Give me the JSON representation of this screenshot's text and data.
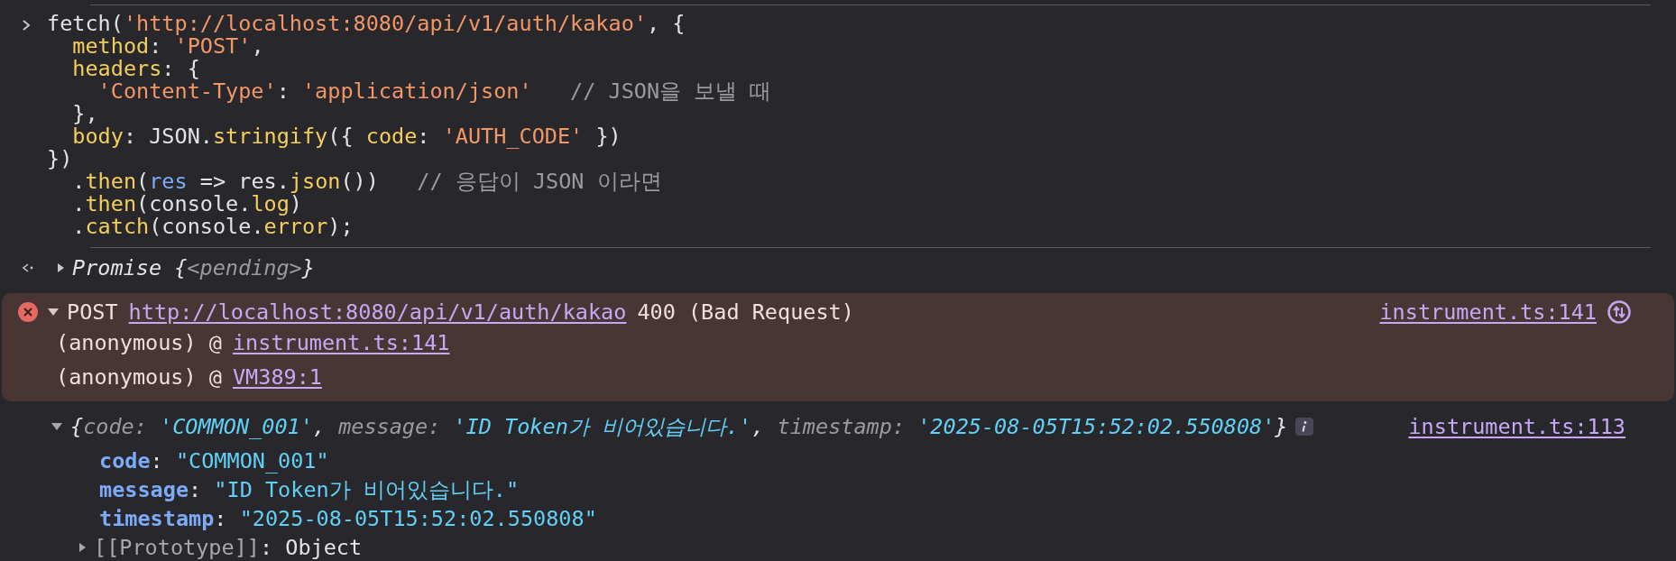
{
  "input": {
    "lines": [
      [
        {
          "kind": "plain",
          "text": "fetch("
        },
        {
          "kind": "string",
          "text": "'http://localhost:8080/api/v1/auth/kakao'"
        },
        {
          "kind": "plain",
          "text": ", {"
        }
      ],
      [
        {
          "kind": "key",
          "text": "  method"
        },
        {
          "kind": "plain",
          "text": ": "
        },
        {
          "kind": "string",
          "text": "'POST'"
        },
        {
          "kind": "plain",
          "text": ","
        }
      ],
      [
        {
          "kind": "key",
          "text": "  headers"
        },
        {
          "kind": "plain",
          "text": ": {"
        }
      ],
      [
        {
          "kind": "string",
          "text": "    'Content-Type'"
        },
        {
          "kind": "plain",
          "text": ": "
        },
        {
          "kind": "string",
          "text": "'application/json'"
        },
        {
          "kind": "comment",
          "text": "   // JSON을 보낼 때"
        }
      ],
      [
        {
          "kind": "plain",
          "text": "  },"
        }
      ],
      [
        {
          "kind": "key",
          "text": "  body"
        },
        {
          "kind": "plain",
          "text": ": JSON."
        },
        {
          "kind": "call",
          "text": "stringify"
        },
        {
          "kind": "plain",
          "text": "({ "
        },
        {
          "kind": "key",
          "text": "code"
        },
        {
          "kind": "plain",
          "text": ": "
        },
        {
          "kind": "string",
          "text": "'AUTH_CODE'"
        },
        {
          "kind": "plain",
          "text": " })"
        }
      ],
      [
        {
          "kind": "plain",
          "text": "})"
        }
      ],
      [
        {
          "kind": "plain",
          "text": "  ."
        },
        {
          "kind": "call",
          "text": "then"
        },
        {
          "kind": "plain",
          "text": "("
        },
        {
          "kind": "param",
          "text": "res"
        },
        {
          "kind": "plain",
          "text": " => res."
        },
        {
          "kind": "call",
          "text": "json"
        },
        {
          "kind": "plain",
          "text": "())   "
        },
        {
          "kind": "comment",
          "text": "// 응답이 JSON 이라면"
        }
      ],
      [
        {
          "kind": "plain",
          "text": "  ."
        },
        {
          "kind": "call",
          "text": "then"
        },
        {
          "kind": "plain",
          "text": "(console."
        },
        {
          "kind": "call",
          "text": "log"
        },
        {
          "kind": "plain",
          "text": ")"
        }
      ],
      [
        {
          "kind": "plain",
          "text": "  ."
        },
        {
          "kind": "call",
          "text": "catch"
        },
        {
          "kind": "plain",
          "text": "(console."
        },
        {
          "kind": "call",
          "text": "error"
        },
        {
          "kind": "plain",
          "text": ");"
        }
      ]
    ]
  },
  "result": {
    "expanded": false,
    "text": [
      {
        "kind": "plain",
        "text": "Promise "
      },
      {
        "kind": "punct",
        "text": "{"
      },
      {
        "kind": "dim",
        "text": "<pending>"
      },
      {
        "kind": "punct",
        "text": "}"
      }
    ]
  },
  "error": {
    "expanded": true,
    "method": "POST",
    "url": "http://localhost:8080/api/v1/auth/kakao",
    "status": "400 (Bad Request)",
    "source": "instrument.ts:141",
    "stack": [
      {
        "caller": "(anonymous) @",
        "link": "instrument.ts:141"
      },
      {
        "caller": "(anonymous) @",
        "link": "VM389:1"
      }
    ]
  },
  "log": {
    "expanded": true,
    "source": "instrument.ts:113",
    "preview": [
      {
        "kind": "punct",
        "text": "{"
      },
      {
        "kind": "pkey",
        "text": "code"
      },
      {
        "kind": "pkey",
        "text": ": "
      },
      {
        "kind": "value",
        "text": "'COMMON_001'"
      },
      {
        "kind": "punct",
        "text": ", "
      },
      {
        "kind": "pkey",
        "text": "message"
      },
      {
        "kind": "pkey",
        "text": ": "
      },
      {
        "kind": "value",
        "text": "'ID Token가 비어있습니다.'"
      },
      {
        "kind": "punct",
        "text": ", "
      },
      {
        "kind": "pkey",
        "text": "timestamp"
      },
      {
        "kind": "pkey",
        "text": ": "
      },
      {
        "kind": "value",
        "text": "'2025-08-05T15:52:02.550808'"
      },
      {
        "kind": "punct",
        "text": "}"
      }
    ],
    "properties": [
      [
        {
          "kind": "propkey",
          "text": "code"
        },
        {
          "kind": "plain",
          "text": ": "
        },
        {
          "kind": "value",
          "text": "\"COMMON_001\""
        }
      ],
      [
        {
          "kind": "propkey",
          "text": "message"
        },
        {
          "kind": "plain",
          "text": ": "
        },
        {
          "kind": "value",
          "text": "\"ID Token가 비어있습니다.\""
        }
      ],
      [
        {
          "kind": "propkey",
          "text": "timestamp"
        },
        {
          "kind": "plain",
          "text": ": "
        },
        {
          "kind": "value",
          "text": "\"2025-08-05T15:52:02.550808\""
        }
      ]
    ],
    "prototype": {
      "expanded": false,
      "text": [
        {
          "kind": "proto",
          "text": "[[Prototype]]"
        },
        {
          "kind": "plain",
          "text": ": Object"
        }
      ]
    }
  }
}
